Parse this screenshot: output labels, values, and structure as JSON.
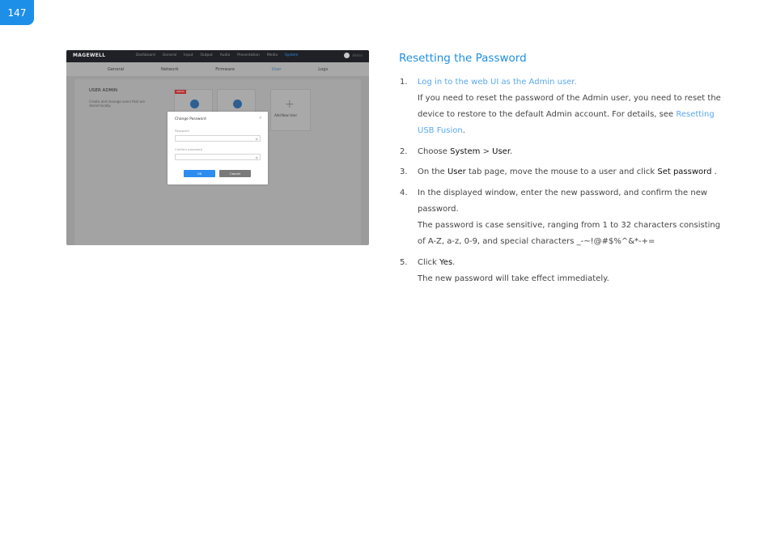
{
  "page": {
    "number": "147"
  },
  "screenshot": {
    "logo": "MAGEWELL",
    "nav": [
      "Dashboard",
      "General",
      "Input",
      "Output",
      "Audio",
      "Presentation",
      "Media",
      "System"
    ],
    "nav_active": "System",
    "user_label": "Admin",
    "tabs": [
      "General",
      "Network",
      "Firmware",
      "User",
      "Logs"
    ],
    "tab_active": "User",
    "panel_title": "USER ADMIN",
    "panel_desc": "Create and manage users that are stored locally.",
    "admin_tag": "Admin",
    "add_new_user": "Add New User",
    "modal": {
      "title": "Change Password",
      "close": "×",
      "password_label": "Password",
      "confirm_label": "Confirm password",
      "ok": "OK",
      "cancel": "Cancel"
    }
  },
  "section": {
    "title": "Resetting the Password",
    "steps": [
      {
        "num": "1.",
        "link": "Log in to the web UI as the Admin user.",
        "line1": "If you need to reset the password of the Admin user, you need to reset the",
        "line2_text": "device to restore to the default Admin account. For details, see ",
        "line2_link": "Resetting",
        "line3_link": "USB Fusion",
        "line3_end": "."
      },
      {
        "num": "2.",
        "pre": "Choose ",
        "b1": "System",
        "sep": " > ",
        "b2": "User",
        "end": "."
      },
      {
        "num": "3.",
        "pre": "On the ",
        "b1": "User",
        "mid": " tab page, move the mouse to a user and click ",
        "b2": "Set password",
        "end": " ."
      },
      {
        "num": "4.",
        "line1": "In the displayed window, enter the new password, and confirm the new",
        "line2": "password.",
        "line3": "The password is case sensitive, ranging from 1 to 32 characters consisting",
        "line4": "of A-Z, a-z, 0-9, and special characters _-~!@#$%^&*-+="
      },
      {
        "num": "5.",
        "pre": "Click ",
        "b1": "Yes",
        "end": ".",
        "line2": "The new password will take effect immediately."
      }
    ]
  }
}
